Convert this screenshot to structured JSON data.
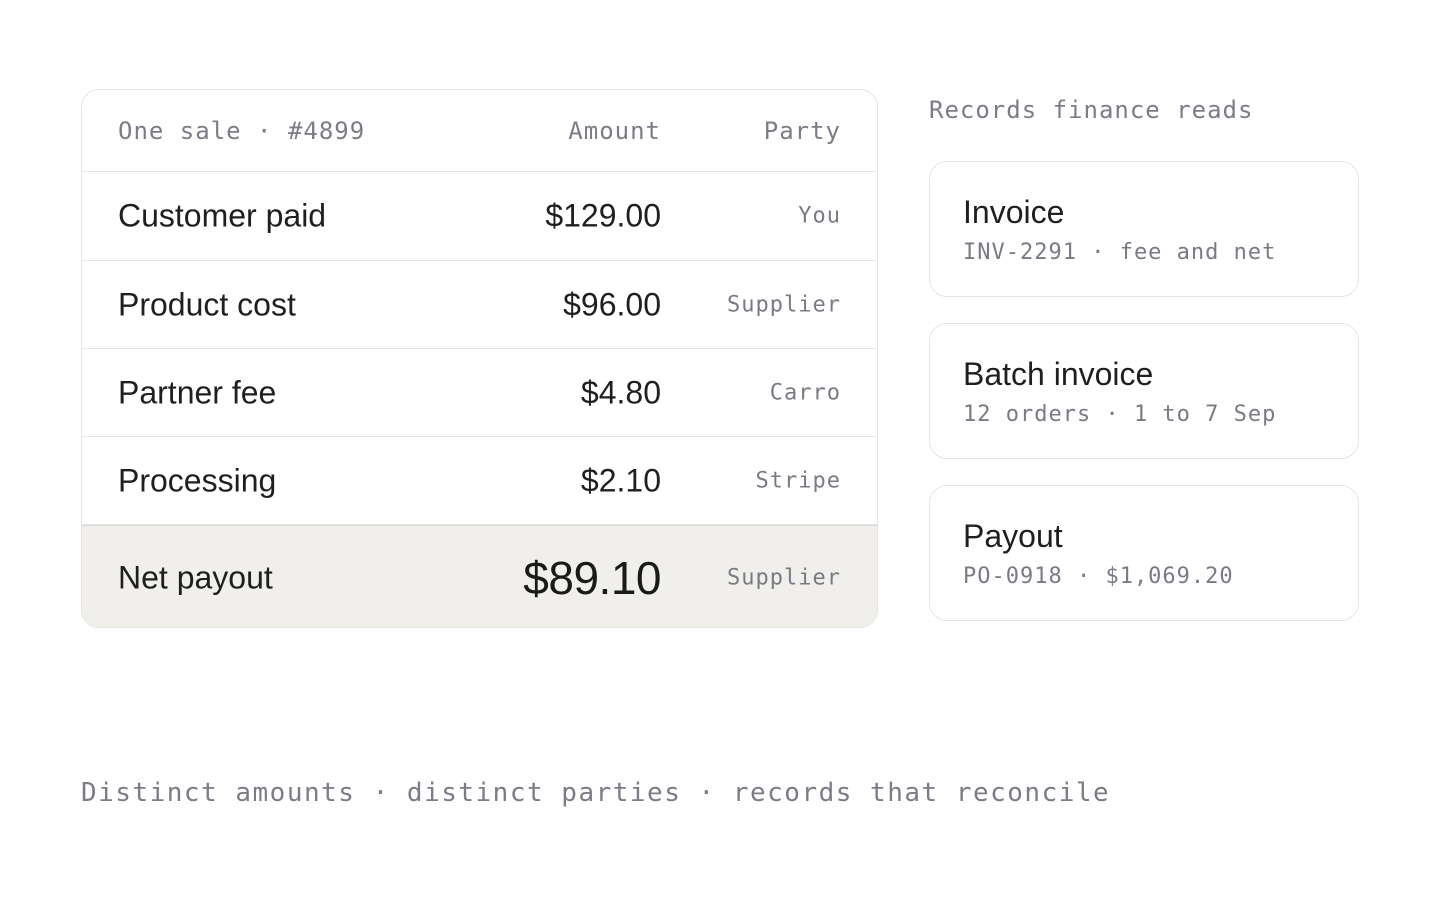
{
  "sale_table": {
    "header": {
      "label": "One sale · #4899",
      "amount": "Amount",
      "party": "Party"
    },
    "rows": [
      {
        "label": "Customer paid",
        "amount": "$129.00",
        "party": "You"
      },
      {
        "label": "Product cost",
        "amount": "$96.00",
        "party": "Supplier"
      },
      {
        "label": "Partner fee",
        "amount": "$4.80",
        "party": "Carro"
      },
      {
        "label": "Processing",
        "amount": "$2.10",
        "party": "Stripe"
      }
    ],
    "total": {
      "label": "Net payout",
      "amount": "$89.10",
      "party": "Supplier"
    }
  },
  "records": {
    "heading": "Records finance reads",
    "items": [
      {
        "title": "Invoice",
        "meta": "INV-2291 · fee and net"
      },
      {
        "title": "Batch invoice",
        "meta": "12 orders · 1 to 7 Sep"
      },
      {
        "title": "Payout",
        "meta": "PO-0918 · $1,069.20"
      }
    ]
  },
  "footer": {
    "note": "Distinct amounts · distinct parties · records that reconcile"
  },
  "colors": {
    "border": "#e4e4e2",
    "total_row_bg": "#f0efec",
    "muted_text": "#7d7c86",
    "primary_text": "#1f1f1f"
  }
}
